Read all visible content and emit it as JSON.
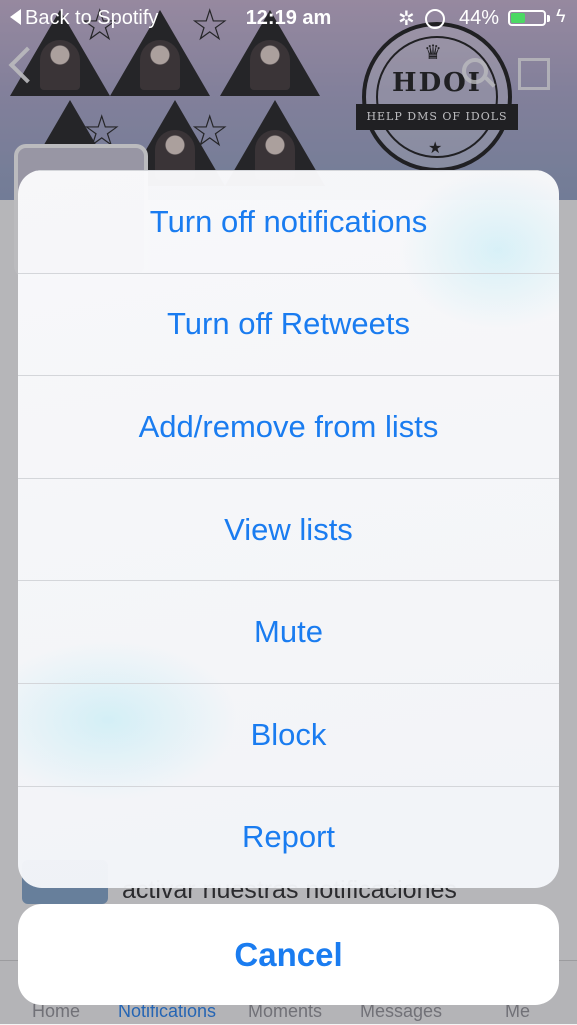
{
  "status_bar": {
    "back_label": "Back to Spotify",
    "time": "12:19 am",
    "battery_percent": "44%",
    "battery_level": 0.44,
    "icons": [
      "activity-spinner-icon",
      "orientation-lock-icon",
      "battery-icon",
      "charging-bolt-icon"
    ]
  },
  "profile_header": {
    "badge_title": "HDOI",
    "badge_subtitle": "HELP DMS OF IDOLS",
    "icons": [
      "back-chevron-icon",
      "search-icon",
      "compose-icon"
    ]
  },
  "background": {
    "tweet_snippet": "activar nuestras notificaciones",
    "tabs": [
      "Home",
      "Notifications",
      "Moments",
      "Messages",
      "Me"
    ]
  },
  "action_sheet": {
    "items": [
      "Turn off notifications",
      "Turn off Retweets",
      "Add/remove from lists",
      "View lists",
      "Mute",
      "Block",
      "Report"
    ],
    "cancel_label": "Cancel"
  },
  "colors": {
    "action_text": "#1a7cf0",
    "battery_fill": "#4cd964",
    "dim_overlay": "rgba(60,60,70,0.35)"
  }
}
